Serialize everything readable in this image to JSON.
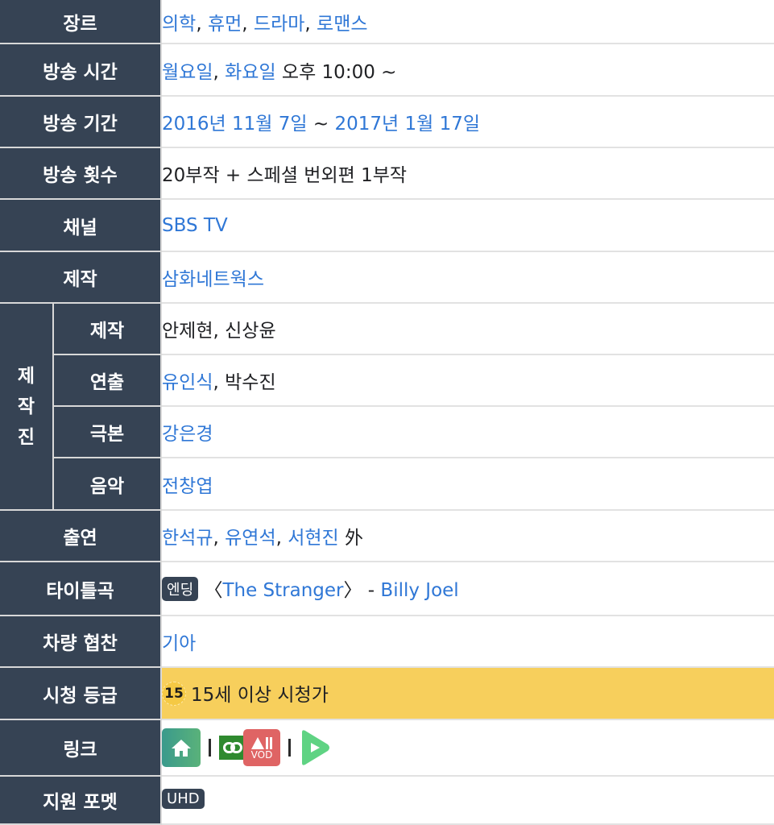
{
  "colors": {
    "label_bg": "#364354",
    "link": "#2f77d6",
    "rating_bg": "#f7cf5c",
    "home_icon": "#4aa67f",
    "link_icon": "#2f8a2f",
    "vod_icon": "#df6464",
    "play_icon": "#5fd383"
  },
  "rows": {
    "genre": {
      "label": "장르",
      "items": [
        "의학",
        "휴먼",
        "드라마",
        "로맨스"
      ],
      "sep": ", "
    },
    "airtime": {
      "label": "방송 시간",
      "days": [
        "월요일",
        "화요일"
      ],
      "sep": ", ",
      "time": " 오후 10:00 ~"
    },
    "period": {
      "label": "방송 기간",
      "start": "2016년 11월 7일",
      "tilde": " ~ ",
      "end": "2017년 1월 17일"
    },
    "episodes": {
      "label": "방송 횟수",
      "value": "20부작 + 스페셜 번외편 1부작"
    },
    "channel": {
      "label": "채널",
      "value": "SBS TV"
    },
    "production": {
      "label": "제작",
      "value": "삼화네트웍스"
    },
    "crew": {
      "group_label": [
        "제",
        "작",
        "진"
      ],
      "producer": {
        "label": "제작",
        "value": "안제현, 신상윤"
      },
      "director": {
        "label": "연출",
        "link": "유인식",
        "rest": ", 박수진"
      },
      "writer": {
        "label": "극본",
        "value": "강은경"
      },
      "music": {
        "label": "음악",
        "value": "전창엽"
      }
    },
    "cast": {
      "label": "출연",
      "items": [
        "한석규",
        "유연석",
        "서현진"
      ],
      "sep": ", ",
      "suffix": " 外"
    },
    "theme": {
      "label": "타이틀곡",
      "tag": "엔딩",
      "open": " 〈",
      "song": "The Stranger",
      "close": "〉 - ",
      "artist": "Billy Joel"
    },
    "sponsor": {
      "label": "차량 협찬",
      "value": "기아"
    },
    "rating": {
      "label": "시청 등급",
      "badge": "15",
      "value": "15세 이상 시청가"
    },
    "links": {
      "label": "링크",
      "icons": [
        "home-icon",
        "link-icon",
        "allvod-icon",
        "play-icon"
      ],
      "vod_top": "All",
      "vod_bottom": "VOD"
    },
    "format": {
      "label": "지원 포멧",
      "tag": "UHD"
    }
  }
}
